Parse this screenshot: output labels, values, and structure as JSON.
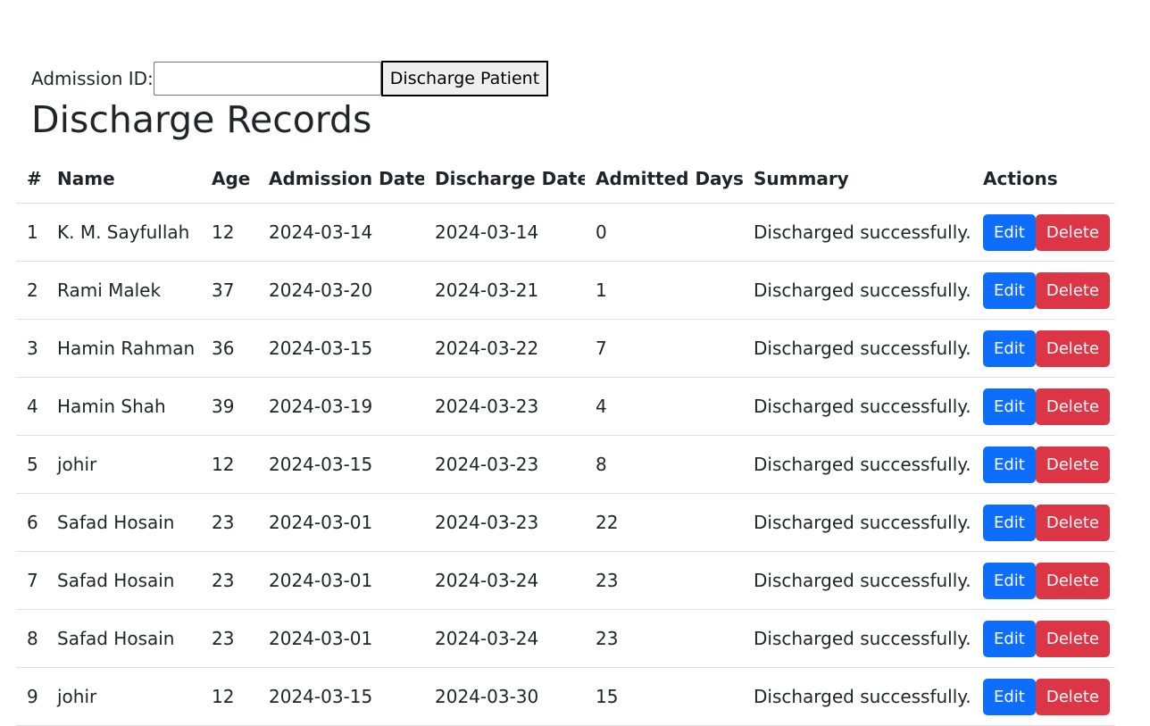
{
  "form": {
    "label": "Admission ID:",
    "input_value": "",
    "input_placeholder": "",
    "submit_label": "Discharge Patient"
  },
  "page_title": "Discharge Records",
  "table": {
    "headers": [
      "#",
      "Name",
      "Age",
      "Admission Date",
      "Discharge Date",
      "Admitted Days",
      "Summary",
      "Actions"
    ],
    "edit_label": "Edit",
    "delete_label": "Delete",
    "rows": [
      [
        "1",
        "K. M. Sayfullah",
        "12",
        "2024-03-14",
        "2024-03-14",
        "0",
        "Discharged successfully."
      ],
      [
        "2",
        "Rami Malek",
        "37",
        "2024-03-20",
        "2024-03-21",
        "1",
        "Discharged successfully."
      ],
      [
        "3",
        "Hamin Rahman",
        "36",
        "2024-03-15",
        "2024-03-22",
        "7",
        "Discharged successfully."
      ],
      [
        "4",
        "Hamin Shah",
        "39",
        "2024-03-19",
        "2024-03-23",
        "4",
        "Discharged successfully."
      ],
      [
        "5",
        "johir",
        "12",
        "2024-03-15",
        "2024-03-23",
        "8",
        "Discharged successfully."
      ],
      [
        "6",
        "Safad Hosain",
        "23",
        "2024-03-01",
        "2024-03-23",
        "22",
        "Discharged successfully."
      ],
      [
        "7",
        "Safad Hosain",
        "23",
        "2024-03-01",
        "2024-03-24",
        "23",
        "Discharged successfully."
      ],
      [
        "8",
        "Safad Hosain",
        "23",
        "2024-03-01",
        "2024-03-24",
        "23",
        "Discharged successfully."
      ],
      [
        "9",
        "johir",
        "12",
        "2024-03-15",
        "2024-03-30",
        "15",
        "Discharged successfully."
      ]
    ]
  },
  "colors": {
    "edit_button": "#0d6efd",
    "delete_button": "#dc3545",
    "row_border": "#dee2e6"
  }
}
